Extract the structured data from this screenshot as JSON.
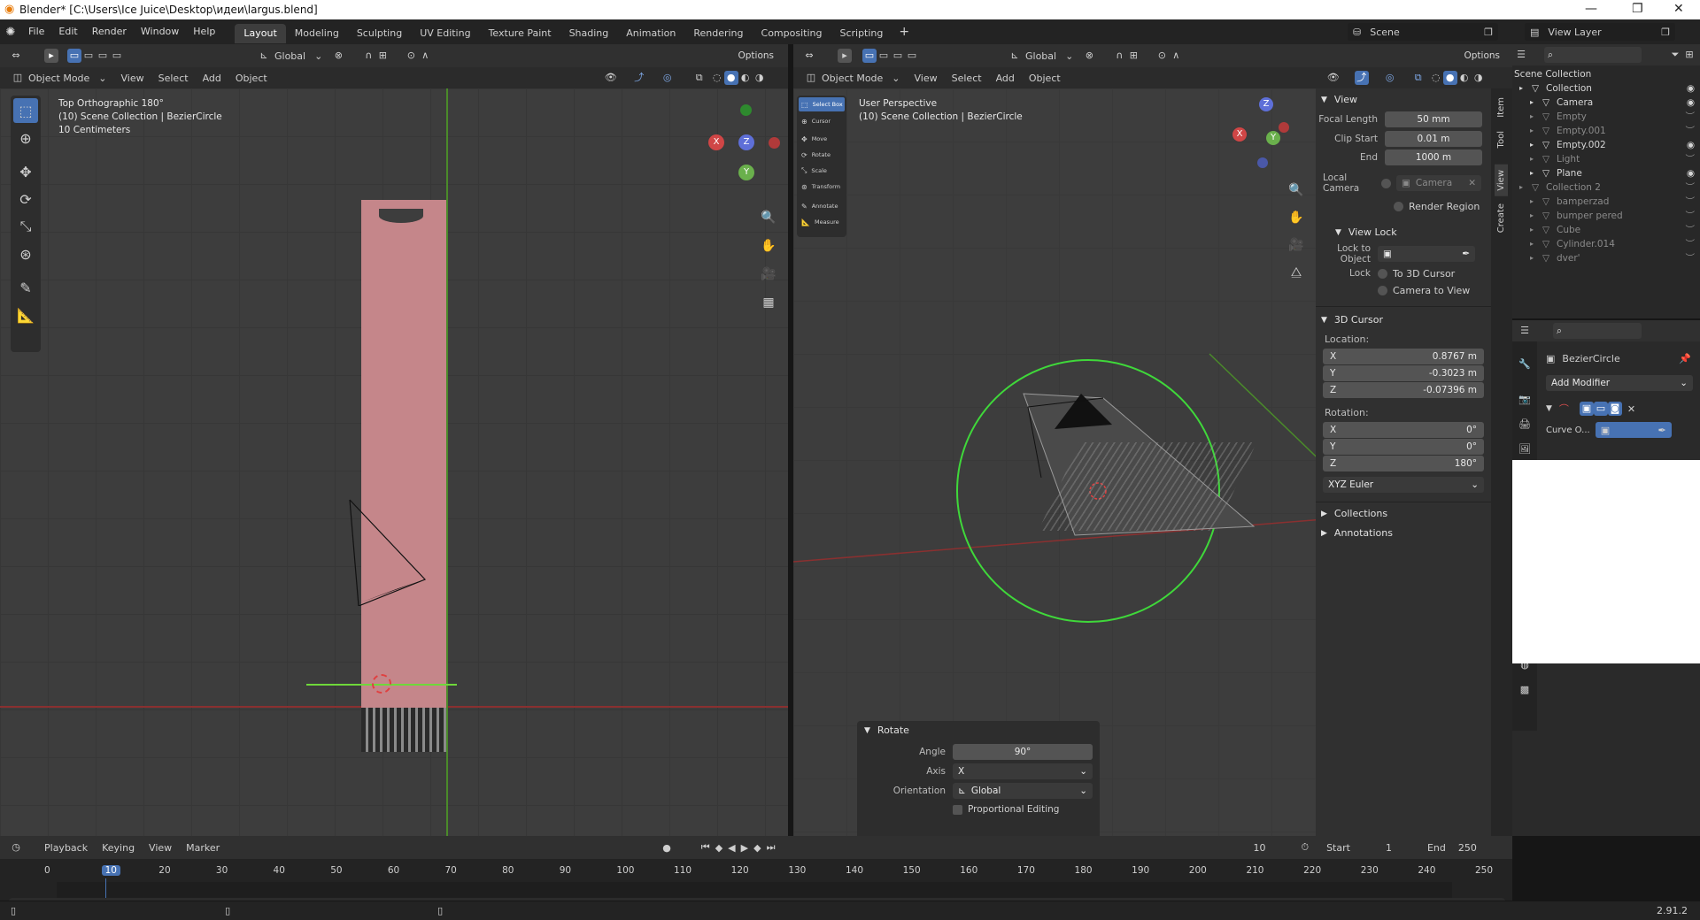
{
  "window": {
    "title": "Blender* [C:\\Users\\Ice Juice\\Desktop\\идеи\\largus.blend]"
  },
  "menu": [
    "File",
    "Edit",
    "Render",
    "Window",
    "Help"
  ],
  "workspaces": [
    "Layout",
    "Modeling",
    "Sculpting",
    "UV Editing",
    "Texture Paint",
    "Shading",
    "Animation",
    "Rendering",
    "Compositing",
    "Scripting"
  ],
  "active_workspace": "Layout",
  "scene": {
    "name": "Scene",
    "view_layer": "View Layer"
  },
  "left_view": {
    "orientation": "Global",
    "options": "Options",
    "mode": "Object Mode",
    "menus": [
      "View",
      "Select",
      "Add",
      "Object"
    ],
    "info": [
      "Top Orthographic 180°",
      "(10) Scene Collection | BezierCircle",
      "10 Centimeters"
    ]
  },
  "right_view": {
    "orientation": "Global",
    "options": "Options",
    "mode": "Object Mode",
    "menus": [
      "View",
      "Select",
      "Add",
      "Object"
    ],
    "info": [
      "User Perspective",
      "(10) Scene Collection | BezierCircle"
    ],
    "tools": [
      "Select Box",
      "Cursor",
      "Move",
      "Rotate",
      "Scale",
      "Transform",
      "Annotate",
      "Measure"
    ]
  },
  "nav_gizmo": {
    "x": "X",
    "y": "Y",
    "z": "Z"
  },
  "side_tabs": [
    "Item",
    "Tool",
    "View",
    "Create"
  ],
  "view_panel": {
    "title": "View",
    "focal_length_label": "Focal Length",
    "focal_length": "50 mm",
    "clip_start_label": "Clip Start",
    "clip_start": "0.01 m",
    "end_label": "End",
    "end": "1000 m",
    "local_camera_label": "Local Camera",
    "local_camera": "Camera",
    "render_region": "Render Region",
    "view_lock": "View Lock",
    "lock_to_object": "Lock to Object",
    "lock_label": "Lock",
    "to_3d_cursor": "To 3D Cursor",
    "camera_to_view": "Camera to View"
  },
  "cursor_panel": {
    "title": "3D Cursor",
    "location_label": "Location:",
    "loc": [
      {
        "axis": "X",
        "value": "0.8767 m"
      },
      {
        "axis": "Y",
        "value": "-0.3023 m"
      },
      {
        "axis": "Z",
        "value": "-0.07396 m"
      }
    ],
    "rotation_label": "Rotation:",
    "rot": [
      {
        "axis": "X",
        "value": "0°"
      },
      {
        "axis": "Y",
        "value": "0°"
      },
      {
        "axis": "Z",
        "value": "180°"
      }
    ],
    "mode": "XYZ Euler"
  },
  "collapsed_panels": [
    "Collections",
    "Annotations"
  ],
  "rotate_op": {
    "title": "Rotate",
    "angle_label": "Angle",
    "angle": "90°",
    "axis_label": "Axis",
    "axis": "X",
    "orientation_label": "Orientation",
    "orientation": "Global",
    "proportional": "Proportional Editing"
  },
  "outliner": {
    "root": "Scene Collection",
    "items": [
      {
        "name": "Collection",
        "dim": false
      },
      {
        "name": "Camera",
        "dim": false
      },
      {
        "name": "Empty",
        "dim": true
      },
      {
        "name": "Empty.001",
        "dim": true
      },
      {
        "name": "Empty.002",
        "dim": false
      },
      {
        "name": "Light",
        "dim": true
      },
      {
        "name": "Plane",
        "dim": false
      },
      {
        "name": "Collection 2",
        "dim": true
      },
      {
        "name": "bamperzad",
        "dim": true
      },
      {
        "name": "bumper pered",
        "dim": true
      },
      {
        "name": "Cube",
        "dim": true
      },
      {
        "name": "Cylinder.014",
        "dim": true
      },
      {
        "name": "dver'",
        "dim": true
      }
    ]
  },
  "properties": {
    "object": "BezierCircle",
    "add_modifier": "Add Modifier",
    "modifier_field": "Curve O..."
  },
  "timeline": {
    "menus": [
      "Playback",
      "Keying",
      "View",
      "Marker"
    ],
    "current_frame": "10",
    "start_label": "Start",
    "start": "1",
    "end_label": "End",
    "end": "250",
    "ticks": [
      "0",
      "10",
      "20",
      "30",
      "40",
      "50",
      "60",
      "70",
      "80",
      "90",
      "100",
      "110",
      "120",
      "130",
      "140",
      "150",
      "160",
      "170",
      "180",
      "190",
      "200",
      "210",
      "220",
      "230",
      "240",
      "250"
    ]
  },
  "status": {
    "version": "2.91.2"
  },
  "colors": {
    "accent": "#4772b3",
    "x_axis": "#c04040",
    "y_axis": "#6ab04c",
    "z_axis": "#4f6fd8",
    "selection": "#ff9a2c"
  }
}
